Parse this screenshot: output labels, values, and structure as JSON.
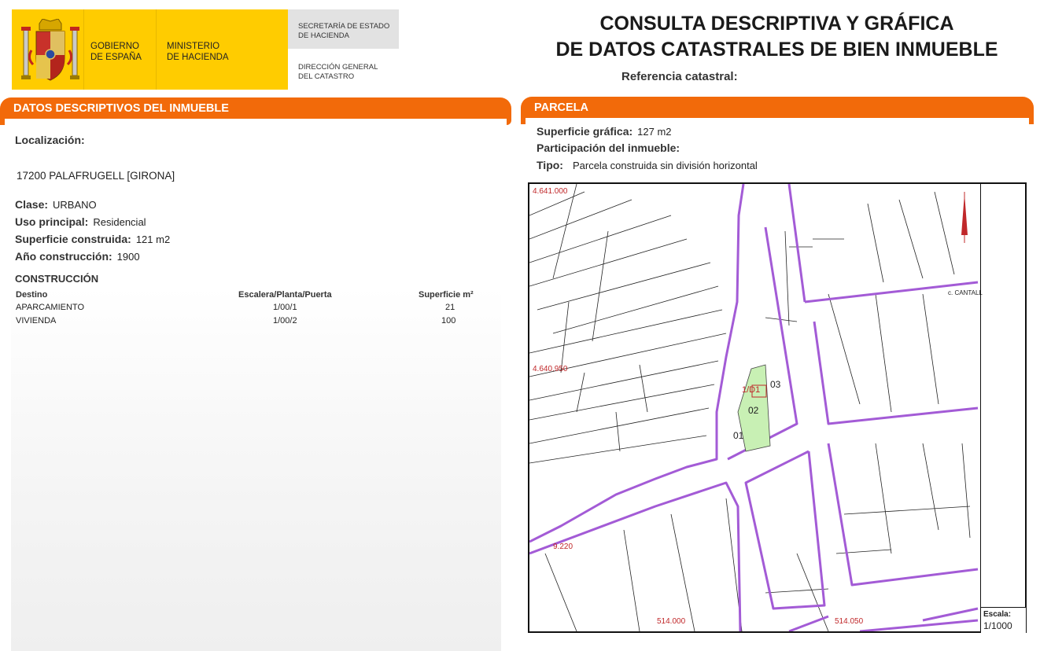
{
  "header": {
    "gov_line1": "GOBIERNO",
    "gov_line2": "DE ESPAÑA",
    "min_line1": "MINISTERIO",
    "min_line2": "DE HACIENDA",
    "sec_line1": "SECRETARÍA DE ESTADO",
    "sec_line2": "DE HACIENDA",
    "dir_line1": "DIRECCIÓN GENERAL",
    "dir_line2": "DEL CATASTRO",
    "title_line1": "CONSULTA DESCRIPTIVA Y GRÁFICA",
    "title_line2": "DE DATOS CATASTRALES DE BIEN INMUEBLE",
    "ref_label": "Referencia catastral:"
  },
  "left": {
    "section_title": "DATOS DESCRIPTIVOS DEL INMUEBLE",
    "localizacion_label": "Localización:",
    "localizacion_value": "17200 PALAFRUGELL [GIRONA]",
    "clase_label": "Clase:",
    "clase_value": "URBANO",
    "uso_label": "Uso principal:",
    "uso_value": "Residencial",
    "sup_label": "Superficie construida:",
    "sup_value": "121 m2",
    "anio_label": "Año construcción:",
    "anio_value": "1900",
    "construccion_title": "CONSTRUCCIÓN",
    "table": {
      "headers": [
        "Destino",
        "Escalera/Planta/Puerta",
        "Superficie m²"
      ],
      "rows": [
        [
          "APARCAMIENTO",
          "1/00/1",
          "21"
        ],
        [
          "VIVIENDA",
          "1/00/2",
          "100"
        ]
      ]
    }
  },
  "right": {
    "section_title": "PARCELA",
    "sup_grafica_label": "Superficie gráfica:",
    "sup_grafica_value": "127 m2",
    "participacion_label": "Participación del inmueble:",
    "tipo_label": "Tipo:",
    "tipo_value": "Parcela construida sin división horizontal"
  },
  "map": {
    "coord_top": "4.641.000",
    "coord_mid": "4.640.950",
    "coord_low": "9.220",
    "coord_bottom_left": "514.000",
    "coord_bottom_right": "514.050",
    "scale_label": "Escala:",
    "scale_value": "1/1000",
    "street_cantal": "c. CANTALL",
    "parcel_labels": [
      "02",
      "03",
      "01",
      "1/D1"
    ],
    "colors": {
      "block_outline": "#a35bd6",
      "parcel_fill": "#c8f0b4",
      "coord_text": "#c0282a",
      "number_text": "#2a2aa0",
      "header_orange": "#f26a0a",
      "logo_gold": "#ffcc00"
    }
  }
}
